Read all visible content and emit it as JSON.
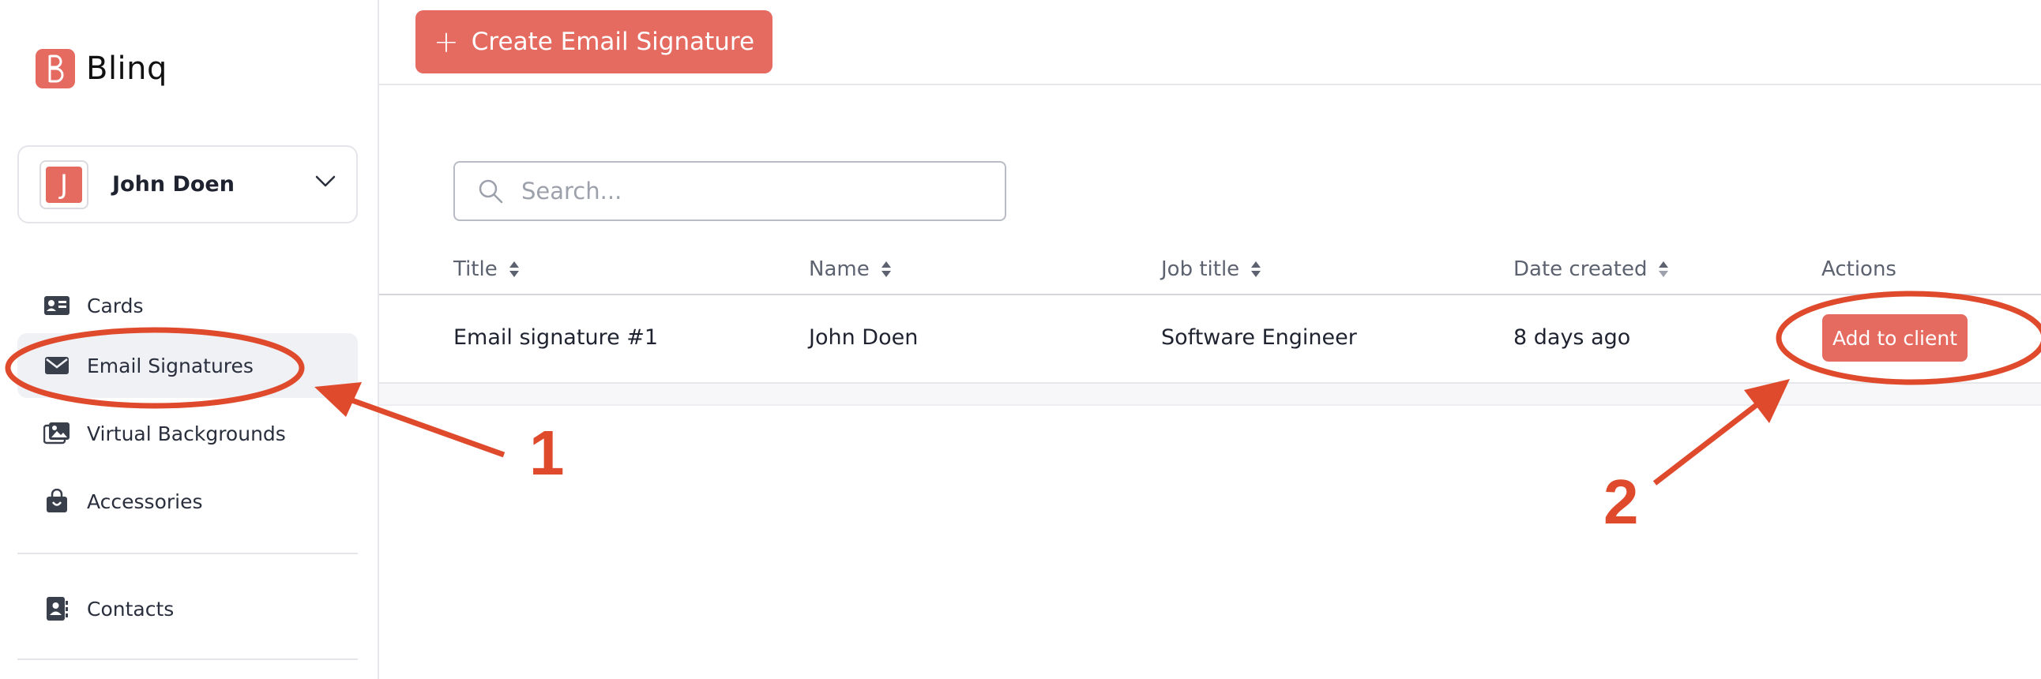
{
  "brand": {
    "name": "Blinq",
    "accent": "#e56a60"
  },
  "account": {
    "initial": "J",
    "name": "John Doen"
  },
  "sidebar": {
    "items": [
      {
        "label": "Cards",
        "icon": "id-card-icon"
      },
      {
        "label": "Email Signatures",
        "icon": "envelope-icon",
        "active": true
      },
      {
        "label": "Virtual Backgrounds",
        "icon": "images-icon"
      },
      {
        "label": "Accessories",
        "icon": "shopping-bag-icon"
      },
      {
        "label": "Contacts",
        "icon": "contact-book-icon"
      }
    ]
  },
  "toolbar": {
    "create_label": "Create Email Signature"
  },
  "search": {
    "placeholder": "Search..."
  },
  "table": {
    "columns": [
      "Title",
      "Name",
      "Job title",
      "Date created",
      "Actions"
    ],
    "rows": [
      {
        "title": "Email signature #1",
        "name": "John Doen",
        "job_title": "Software Engineer",
        "date_created": "8 days ago",
        "action_label": "Add to client"
      }
    ]
  },
  "annotations": {
    "step1": "1",
    "step2": "2",
    "color": "#e04a2c"
  }
}
